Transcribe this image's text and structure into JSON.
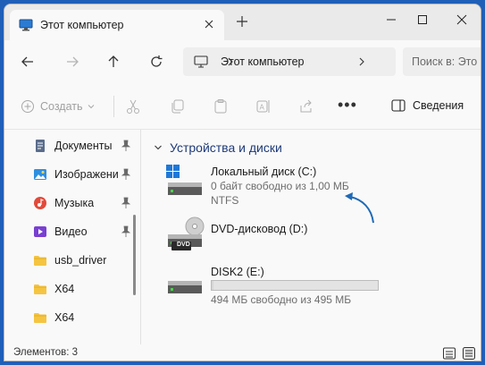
{
  "window": {
    "tab_title": "Этот компьютер",
    "minimize": "minimize",
    "maximize": "maximize",
    "close": "close"
  },
  "address": {
    "path": "Этот компьютер",
    "search_placeholder": "Поиск в: Это"
  },
  "toolbar": {
    "create_label": "Создать",
    "details_label": "Сведения",
    "more_label": "•••"
  },
  "sidebar": {
    "items": [
      {
        "label": "Документы",
        "icon": "documents-icon",
        "pinned": true
      },
      {
        "label": "Изображени",
        "icon": "pictures-icon",
        "pinned": true
      },
      {
        "label": "Музыка",
        "icon": "music-icon",
        "pinned": true
      },
      {
        "label": "Видео",
        "icon": "video-icon",
        "pinned": true
      },
      {
        "label": "usb_driver",
        "icon": "folder-icon",
        "pinned": false
      },
      {
        "label": "X64",
        "icon": "folder-icon",
        "pinned": false
      },
      {
        "label": "X64",
        "icon": "folder-icon",
        "pinned": false
      }
    ]
  },
  "main": {
    "group_title": "Устройства и диски",
    "drives": [
      {
        "name": "Локальный диск (C:)",
        "free": "0 байт свободно из 1,00 МБ",
        "fs": "NTFS",
        "used_fraction": 1.0
      },
      {
        "name": "DVD-дисковод (D:)",
        "badge": "DVD"
      },
      {
        "name": "DISK2 (E:)",
        "free": "494 МБ свободно из 495 МБ",
        "used_fraction": 0.01
      }
    ]
  },
  "status": {
    "items_count": "Элементов: 3"
  },
  "colors": {
    "accent": "#1f6ab5",
    "folder": "#f5c542",
    "desktop": "#1f5fb8"
  }
}
